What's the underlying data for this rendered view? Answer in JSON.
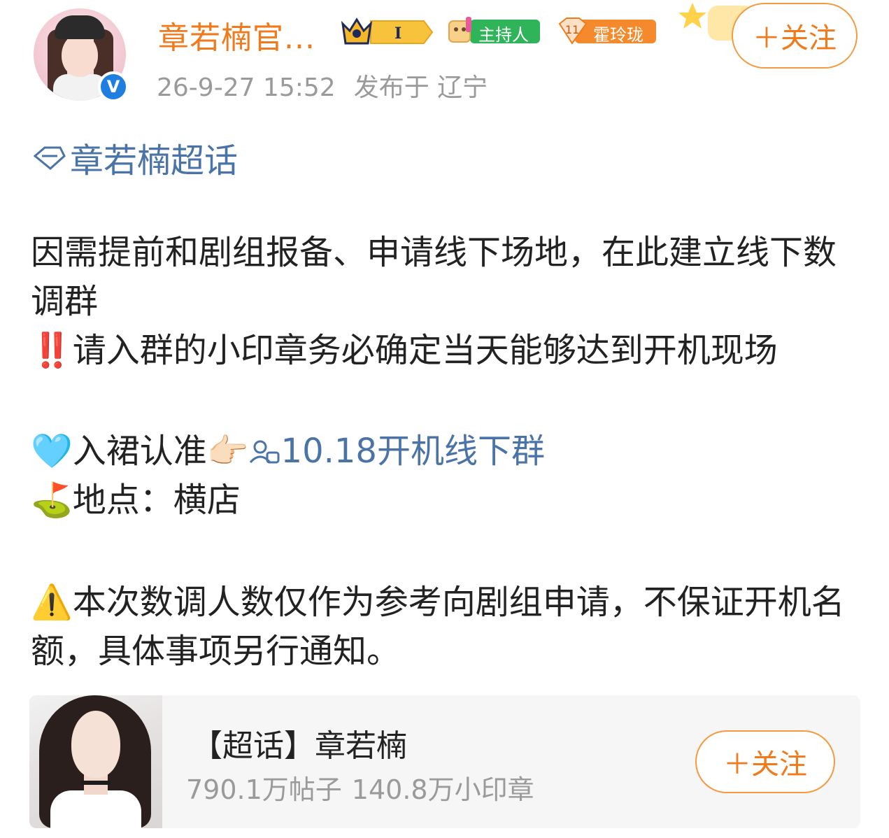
{
  "post": {
    "author": {
      "name": "章若楠官...",
      "verified_mark": "V"
    },
    "badges": {
      "rank_letter": "I",
      "host_label": "主持人",
      "level_number": "11",
      "level_name": "霍玲珑"
    },
    "follow_label": "＋关注",
    "timestamp": "26-9-27 15:52",
    "location": "发布于 辽宁",
    "topic_link": "章若楠超话",
    "paragraph_1": "因需提前和剧组报备、申请线下场地，在此建立线下数调群",
    "paragraph_2_emoji": "‼️",
    "paragraph_2": "请入群的小印章务必确定当天能够达到开机现场",
    "paragraph_3_emoji": "🩵",
    "paragraph_3_prefix": "入裙认准",
    "paragraph_3_point": "👉🏻",
    "group_link": "10.18开机线下群",
    "paragraph_4_emoji": "⛳",
    "paragraph_4": "地点：横店",
    "paragraph_5_emoji": "⚠️",
    "paragraph_5": "本次数调人数仅作为参考向剧组申请，不保证开机名额，具体事项另行通知。"
  },
  "topic_card": {
    "title": "【超话】章若楠",
    "posts": "790.1万帖子",
    "members": "140.8万小印章",
    "follow_label": "＋关注"
  },
  "colors": {
    "accent_orange": "#f07a1c",
    "link_blue": "#4a73a8",
    "meta_gray": "#9a9a9a"
  }
}
